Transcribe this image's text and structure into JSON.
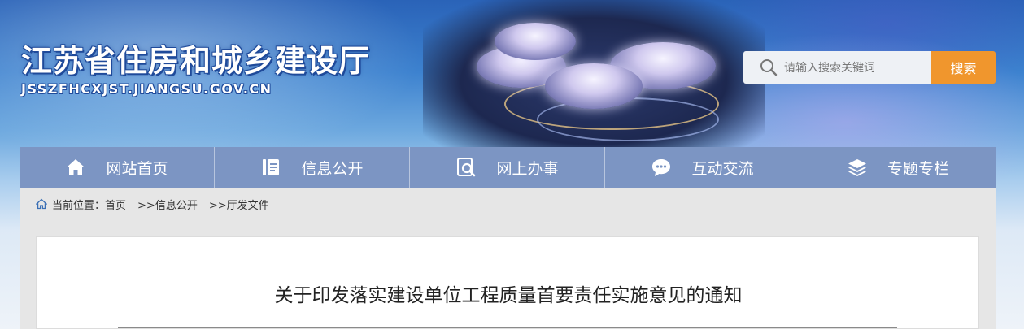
{
  "header": {
    "title": "江苏省住房和城乡建设厅",
    "domain": "JSSZFHCXJST.JIANGSU.GOV.CN"
  },
  "search": {
    "placeholder": "请输入搜索关键词",
    "button_label": "搜索"
  },
  "nav": {
    "items": [
      {
        "label": "网站首页",
        "icon": "home-icon"
      },
      {
        "label": "信息公开",
        "icon": "document-icon"
      },
      {
        "label": "网上办事",
        "icon": "search-document-icon"
      },
      {
        "label": "互动交流",
        "icon": "chat-icon"
      },
      {
        "label": "专题专栏",
        "icon": "layers-icon"
      }
    ]
  },
  "breadcrumb": {
    "prefix": "当前位置：",
    "items": [
      "首页",
      ">>信息公开",
      ">>厅发文件"
    ]
  },
  "article": {
    "title": "关于印发落实建设单位工程质量首要责任实施意见的通知"
  },
  "colors": {
    "nav_bg": "#7c95c3",
    "search_button": "#f0962d",
    "breadcrumb_bg": "#e6e6e6"
  }
}
